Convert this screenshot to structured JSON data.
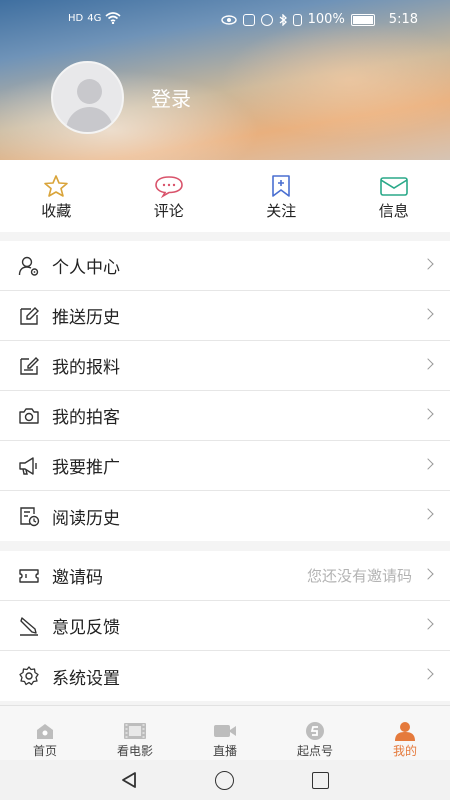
{
  "status_bar": {
    "left_indicators": [
      "HD",
      "4G"
    ],
    "battery_percent": "100%",
    "time": "5:18"
  },
  "profile": {
    "login_label": "登录"
  },
  "quick_actions": [
    {
      "label": "收藏",
      "icon": "star-icon",
      "color": "#d9a43a"
    },
    {
      "label": "评论",
      "icon": "comment-icon",
      "color": "#d9536b"
    },
    {
      "label": "关注",
      "icon": "bookmark-add-icon",
      "color": "#4a6fd1"
    },
    {
      "label": "信息",
      "icon": "mail-icon",
      "color": "#2aa989"
    }
  ],
  "menu_group_1": [
    {
      "label": "个人中心",
      "icon": "user-settings-icon"
    },
    {
      "label": "推送历史",
      "icon": "edit-icon"
    },
    {
      "label": "我的报料",
      "icon": "edit-note-icon"
    },
    {
      "label": "我的拍客",
      "icon": "camera-icon"
    },
    {
      "label": "我要推广",
      "icon": "megaphone-icon"
    },
    {
      "label": "阅读历史",
      "icon": "history-icon"
    }
  ],
  "menu_group_2": [
    {
      "label": "邀请码",
      "icon": "ticket-icon",
      "hint": "您还没有邀请码"
    },
    {
      "label": "意见反馈",
      "icon": "feedback-icon"
    },
    {
      "label": "系统设置",
      "icon": "gear-icon"
    }
  ],
  "tabs": [
    {
      "label": "首页",
      "icon": "home-icon",
      "active": false
    },
    {
      "label": "看电影",
      "icon": "film-icon",
      "active": false
    },
    {
      "label": "直播",
      "icon": "video-camera-icon",
      "active": false
    },
    {
      "label": "起点号",
      "icon": "qidian-icon",
      "active": false
    },
    {
      "label": "我的",
      "icon": "person-icon",
      "active": true
    }
  ],
  "colors": {
    "accent": "#e57a3c"
  }
}
